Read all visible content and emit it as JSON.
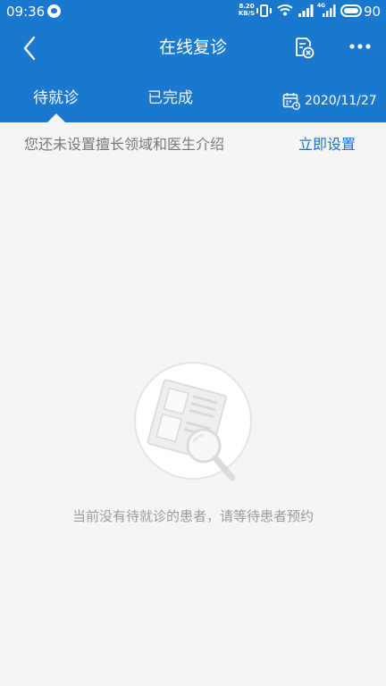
{
  "status_bar": {
    "time": "09:36",
    "net_speed_value": "8.20",
    "net_speed_unit": "KB/S",
    "network_type": "4G",
    "battery_level": "90"
  },
  "nav": {
    "title": "在线复诊",
    "back_icon": "chevron-left-icon",
    "record_icon": "document-cancel-icon",
    "more_icon": "more-dots-icon"
  },
  "tabs": [
    {
      "label": "待就诊",
      "active": true
    },
    {
      "label": "已完成",
      "active": false
    }
  ],
  "date_filter": {
    "icon": "calendar-icon",
    "value": "2020/11/27"
  },
  "notice": {
    "message": "您还未设置擅长领域和医生介绍",
    "action_label": "立即设置"
  },
  "empty_state": {
    "icon": "search-document-icon",
    "message": "当前没有待就诊的患者，请等待患者预约"
  },
  "colors": {
    "header_bg": "#1a78cf",
    "page_bg": "#f5f5f5",
    "link": "#1a6fd1",
    "muted_text": "#9a9a9a"
  }
}
